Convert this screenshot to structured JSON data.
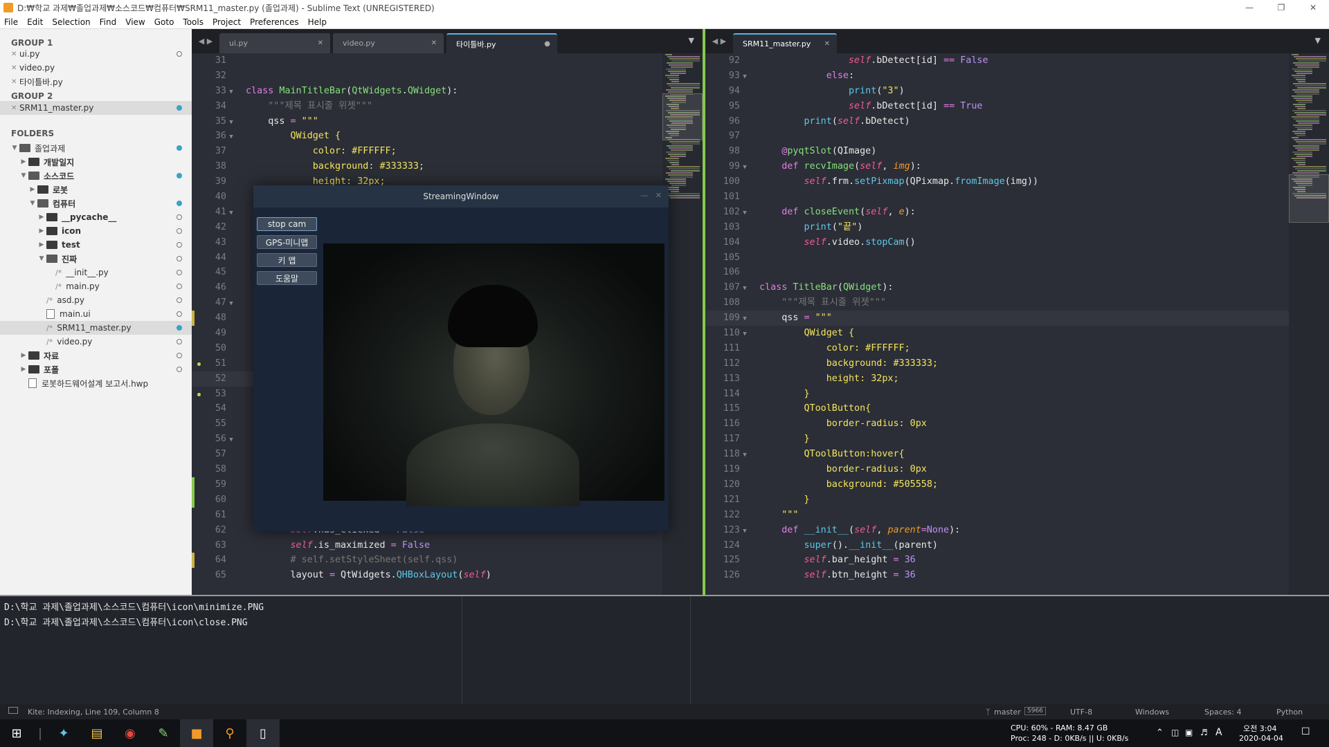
{
  "window": {
    "title": "D:₩학교 과제₩졸업과제₩소스코드₩컴퓨터₩SRM11_master.py (졸업과제) - Sublime Text (UNREGISTERED)"
  },
  "menu": [
    "File",
    "Edit",
    "Selection",
    "Find",
    "View",
    "Goto",
    "Tools",
    "Project",
    "Preferences",
    "Help"
  ],
  "sidebar": {
    "group1_label": "GROUP 1",
    "group1": [
      "ui.py",
      "video.py",
      "타이틀바.py"
    ],
    "group2_label": "GROUP 2",
    "group2": [
      "SRM11_master.py"
    ],
    "folders_label": "FOLDERS",
    "tree": [
      {
        "label": "졸업과제",
        "kind": "folder-open",
        "indent": 0,
        "dot": "f"
      },
      {
        "label": "개발일지",
        "kind": "folder",
        "indent": 1,
        "dot": ""
      },
      {
        "label": "소스코드",
        "kind": "folder-open",
        "indent": 1,
        "dot": "f"
      },
      {
        "label": "로봇",
        "kind": "folder",
        "indent": 2,
        "dot": ""
      },
      {
        "label": "컴퓨터",
        "kind": "folder-open",
        "indent": 2,
        "dot": "f"
      },
      {
        "label": "__pycache__",
        "kind": "folder",
        "indent": 3,
        "dot": "o"
      },
      {
        "label": "icon",
        "kind": "folder",
        "indent": 3,
        "dot": "o"
      },
      {
        "label": "test",
        "kind": "folder",
        "indent": 3,
        "dot": "o"
      },
      {
        "label": "진짜",
        "kind": "folder-open",
        "indent": 3,
        "dot": "o"
      },
      {
        "label": "__init__.py",
        "kind": "py",
        "indent": 4,
        "dot": "o"
      },
      {
        "label": "main.py",
        "kind": "py",
        "indent": 4,
        "dot": "o"
      },
      {
        "label": "asd.py",
        "kind": "py",
        "indent": 3,
        "dot": "o"
      },
      {
        "label": "main.ui",
        "kind": "file",
        "indent": 3,
        "dot": "o"
      },
      {
        "label": "SRM11_master.py",
        "kind": "py",
        "indent": 3,
        "dot": "f",
        "sel": true
      },
      {
        "label": "video.py",
        "kind": "py",
        "indent": 3,
        "dot": "o"
      },
      {
        "label": "자료",
        "kind": "folder",
        "indent": 1,
        "dot": "o"
      },
      {
        "label": "포폴",
        "kind": "folder",
        "indent": 1,
        "dot": "o"
      },
      {
        "label": "로봇하드웨어설계 보고서.hwp",
        "kind": "file",
        "indent": 1,
        "dot": ""
      }
    ]
  },
  "left_pane": {
    "tabs": [
      {
        "label": "ui.py",
        "state": "close"
      },
      {
        "label": "video.py",
        "state": "close"
      },
      {
        "label": "타이틀바.py",
        "state": "dirty",
        "active": true
      }
    ],
    "lines": [
      {
        "n": "31",
        "html": ""
      },
      {
        "n": "32",
        "html": ""
      },
      {
        "n": "33",
        "fold": true,
        "html": "<span class='kw'>class</span> <span class='cls'>MainTitleBar</span>(<span class='cls'>QtWidgets</span>.<span class='cls'>QWidget</span>):"
      },
      {
        "n": "34",
        "html": "    <span class='cmt'>\"\"\"제목 표시줄 위젯\"\"\"</span>"
      },
      {
        "n": "35",
        "fold": true,
        "html": "    qss <span class='kw'>=</span> <span class='str'>\"\"\"</span>"
      },
      {
        "n": "36",
        "fold": true,
        "html": "        <span class='str'>QWidget {</span>"
      },
      {
        "n": "37",
        "html": "            <span class='str'>color: #FFFFFF;</span>"
      },
      {
        "n": "38",
        "html": "            <span class='str'>background: #333333;</span>"
      },
      {
        "n": "39",
        "html": "            <span class='str'>height: 32px;</span>"
      },
      {
        "n": "40",
        "html": ""
      },
      {
        "n": "41",
        "fold": true,
        "html": ""
      },
      {
        "n": "42",
        "html": ""
      },
      {
        "n": "43",
        "html": ""
      },
      {
        "n": "44",
        "html": ""
      },
      {
        "n": "45",
        "html": ""
      },
      {
        "n": "46",
        "html": ""
      },
      {
        "n": "47",
        "fold": true,
        "html": ""
      },
      {
        "n": "48",
        "mark": "#c8b44a",
        "html": ""
      },
      {
        "n": "49",
        "html": ""
      },
      {
        "n": "50",
        "html": ""
      },
      {
        "n": "51",
        "dotmark": true,
        "html": ""
      },
      {
        "n": "52",
        "hl": true,
        "html": ""
      },
      {
        "n": "53",
        "dotmark": true,
        "html": ""
      },
      {
        "n": "54",
        "html": ""
      },
      {
        "n": "55",
        "html": ""
      },
      {
        "n": "56",
        "fold": true,
        "html": ""
      },
      {
        "n": "57",
        "html": ""
      },
      {
        "n": "58",
        "html": ""
      },
      {
        "n": "59",
        "mark": "#87c94f",
        "html": ""
      },
      {
        "n": "60",
        "mark": "#87c94f",
        "html": ""
      },
      {
        "n": "61",
        "html": ""
      },
      {
        "n": "62",
        "html": "        <span class='sf'>self</span>.has_clicked <span class='kw'>=</span> <span class='nm'>False</span>"
      },
      {
        "n": "63",
        "html": "        <span class='sf'>self</span>.is_maximized <span class='kw'>=</span> <span class='nm'>False</span>"
      },
      {
        "n": "64",
        "mark": "#c8b44a",
        "html": "        <span class='cmt'># self.setStyleSheet(self.qss)</span>"
      },
      {
        "n": "65",
        "html": "        layout <span class='kw'>=</span> QtWidgets.<span class='fn'>QHBoxLayout</span>(<span class='sf'>self</span>)"
      }
    ]
  },
  "right_pane": {
    "tabs": [
      {
        "label": "SRM11_master.py",
        "state": "close",
        "active": true
      }
    ],
    "lines": [
      {
        "n": "92",
        "html": "                <span class='sf'>self</span>.bDetect[id] <span class='kw'>==</span> <span class='nm'>False</span>"
      },
      {
        "n": "93",
        "fold": true,
        "html": "            <span class='kw'>else</span>:"
      },
      {
        "n": "94",
        "html": "                <span class='fn'>print</span>(<span class='str'>\"3\"</span>)"
      },
      {
        "n": "95",
        "html": "                <span class='sf'>self</span>.bDetect[id] <span class='kw'>==</span> <span class='nm'>True</span>"
      },
      {
        "n": "96",
        "html": "        <span class='fn'>print</span>(<span class='sf'>self</span>.bDetect)"
      },
      {
        "n": "97",
        "html": ""
      },
      {
        "n": "98",
        "html": "    <span class='kw'>@</span><span class='cls'>pyqtSlot</span>(QImage)"
      },
      {
        "n": "99",
        "fold": true,
        "html": "    <span class='kw'>def</span> <span class='cls'>recvImage</span>(<span class='sf'>self</span>, <span class='arg'>img</span>):"
      },
      {
        "n": "100",
        "html": "        <span class='sf'>self</span>.frm.<span class='fn'>setPixmap</span>(QPixmap.<span class='fn'>fromImage</span>(img))"
      },
      {
        "n": "101",
        "html": ""
      },
      {
        "n": "102",
        "fold": true,
        "html": "    <span class='kw'>def</span> <span class='cls'>closeEvent</span>(<span class='sf'>self</span>, <span class='arg'>e</span>):"
      },
      {
        "n": "103",
        "html": "        <span class='fn'>print</span>(<span class='str'>\"끝\"</span>)"
      },
      {
        "n": "104",
        "html": "        <span class='sf'>self</span>.video.<span class='fn'>stopCam</span>()"
      },
      {
        "n": "105",
        "html": ""
      },
      {
        "n": "106",
        "html": ""
      },
      {
        "n": "107",
        "fold": true,
        "html": "<span class='kw'>class</span> <span class='cls'>TitleBar</span>(<span class='cls'>QWidget</span>):"
      },
      {
        "n": "108",
        "html": "    <span class='cmt'>\"\"\"제목 표시줄 위젯\"\"\"</span>"
      },
      {
        "n": "109",
        "fold": true,
        "hl": true,
        "html": "    qss <span class='kw'>=</span> <span class='str'>\"\"\"</span>"
      },
      {
        "n": "110",
        "fold": true,
        "html": "        <span class='str'>QWidget {</span>"
      },
      {
        "n": "111",
        "html": "            <span class='str'>color: #FFFFFF;</span>"
      },
      {
        "n": "112",
        "html": "            <span class='str'>background: #333333;</span>"
      },
      {
        "n": "113",
        "html": "            <span class='str'>height: 32px;</span>"
      },
      {
        "n": "114",
        "html": "        <span class='str'>}</span>"
      },
      {
        "n": "115",
        "html": "        <span class='str'>QToolButton{</span>"
      },
      {
        "n": "116",
        "html": "            <span class='str'>border-radius: 0px</span>"
      },
      {
        "n": "117",
        "html": "        <span class='str'>}</span>"
      },
      {
        "n": "118",
        "fold": true,
        "html": "        <span class='str'>QToolButton:hover{</span>"
      },
      {
        "n": "119",
        "html": "            <span class='str'>border-radius: 0px</span>"
      },
      {
        "n": "120",
        "html": "            <span class='str'>background: #505558;</span>"
      },
      {
        "n": "121",
        "html": "        <span class='str'>}</span>"
      },
      {
        "n": "122",
        "html": "    <span class='str'>\"\"\"</span>"
      },
      {
        "n": "123",
        "fold": true,
        "html": "    <span class='kw'>def</span> <span class='fn'>__init__</span>(<span class='sf'>self</span>, <span class='arg'>parent</span><span class='kw'>=</span><span class='nm'>None</span>):"
      },
      {
        "n": "124",
        "html": "        <span class='fn'>super</span>().<span class='fn'>__init__</span>(parent)"
      },
      {
        "n": "125",
        "html": "        <span class='sf'>self</span>.bar_height <span class='kw'>=</span> <span class='nm'>36</span>"
      },
      {
        "n": "126",
        "html": "        <span class='sf'>self</span>.btn_height <span class='kw'>=</span> <span class='nm'>36</span>"
      }
    ]
  },
  "streaming_window": {
    "title": "StreamingWindow",
    "buttons": [
      "stop cam",
      "GPS-미니맵",
      "키 맵",
      "도움말"
    ]
  },
  "console": {
    "lines": [
      "D:\\학교 과제\\졸업과제\\소스코드\\컴퓨터\\icon\\minimize.PNG",
      "D:\\학교 과제\\졸업과제\\소스코드\\컴퓨터\\icon\\close.PNG"
    ]
  },
  "status": {
    "left": "Kite: Indexing, Line 109, Column 8",
    "branch": "master",
    "branch_count": "5966",
    "encoding": "UTF-8",
    "line_endings": "Windows",
    "indent": "Spaces: 4",
    "syntax": "Python"
  },
  "taskbar": {
    "cpu": "CPU: 60% - RAM: 8.47 GB",
    "proc": "Proc: 248 - D: 0KB/s || U: 0KB/s",
    "time": "오전 3:04",
    "date": "2020-04-04",
    "ime": "A"
  }
}
